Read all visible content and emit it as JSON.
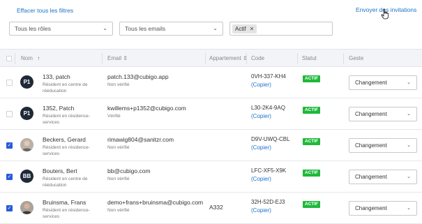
{
  "header": {
    "clear_filters": "Effacer tous les filtres",
    "send_invitations": "Envoyer des invitations"
  },
  "filters": {
    "roles": "Tous les rôles",
    "emails": "Tous les emails",
    "status_tag": "Actif",
    "tag_remove": "✕"
  },
  "columns": {
    "nom": "Nom",
    "nom_sort": "↑",
    "email": "Email ⇕",
    "appartement": "Appartement ⇕",
    "code": "Code",
    "statut": "Statut",
    "geste": "Geste"
  },
  "rows": [
    {
      "checked": false,
      "avatar": "P1",
      "name": "133, patch",
      "role": "Résident en centre de rééducation",
      "email": "patch.133@cubigo.app",
      "verified": "Non vérifié",
      "apartment": "",
      "code": "0VH-337-KH4",
      "copy": "(Copier)",
      "status": "ACTIF",
      "action": "Changement"
    },
    {
      "checked": false,
      "avatar": "P1",
      "name": "1352, Patch",
      "role": "Résident en résidence-services",
      "email": "kwillems+p1352@cubigo.com",
      "verified": "Vérifié",
      "apartment": "",
      "code": "L30-2K4-9AQ",
      "copy": "(Copier)",
      "status": "ACTIF",
      "action": "Changement"
    },
    {
      "checked": true,
      "avatar": "",
      "name": "Beckers, Gerard",
      "role": "Résident en résidence-services",
      "email": "rimawig804@sanitzr.com",
      "verified": "Non vérifié",
      "apartment": "",
      "code": "D9V-UWQ-CBL",
      "copy": "(Copier)",
      "status": "ACTIF",
      "action": "Changement"
    },
    {
      "checked": true,
      "avatar": "BB",
      "name": "Bouters, Bert",
      "role": "Résident en centre de rééducation",
      "email": "bb@cubigo.com",
      "verified": "Non vérifié",
      "apartment": "",
      "code": "LFC-XF5-X9K",
      "copy": "(Copier)",
      "status": "ACTIF",
      "action": "Changement"
    },
    {
      "checked": true,
      "avatar": "",
      "name": "Bruinsma, Frans",
      "role": "Résident en résidence-services",
      "email": "demo+frans+bruinsma@cubigo.com",
      "verified": "Non vérifié",
      "apartment": "A332",
      "code": "32H-52D-EJ3",
      "copy": "(Copier)",
      "status": "ACTIF",
      "action": "Changement"
    }
  ],
  "icons": {
    "chevron": "chevron-down-icon",
    "check": "checkmark-icon",
    "cursor": "hand-pointer-icon"
  },
  "colors": {
    "link": "#1a73c8",
    "status_active": "#1fb83a",
    "checkbox_checked": "#2a5bd7",
    "avatar_dark": "#1f2a38"
  }
}
